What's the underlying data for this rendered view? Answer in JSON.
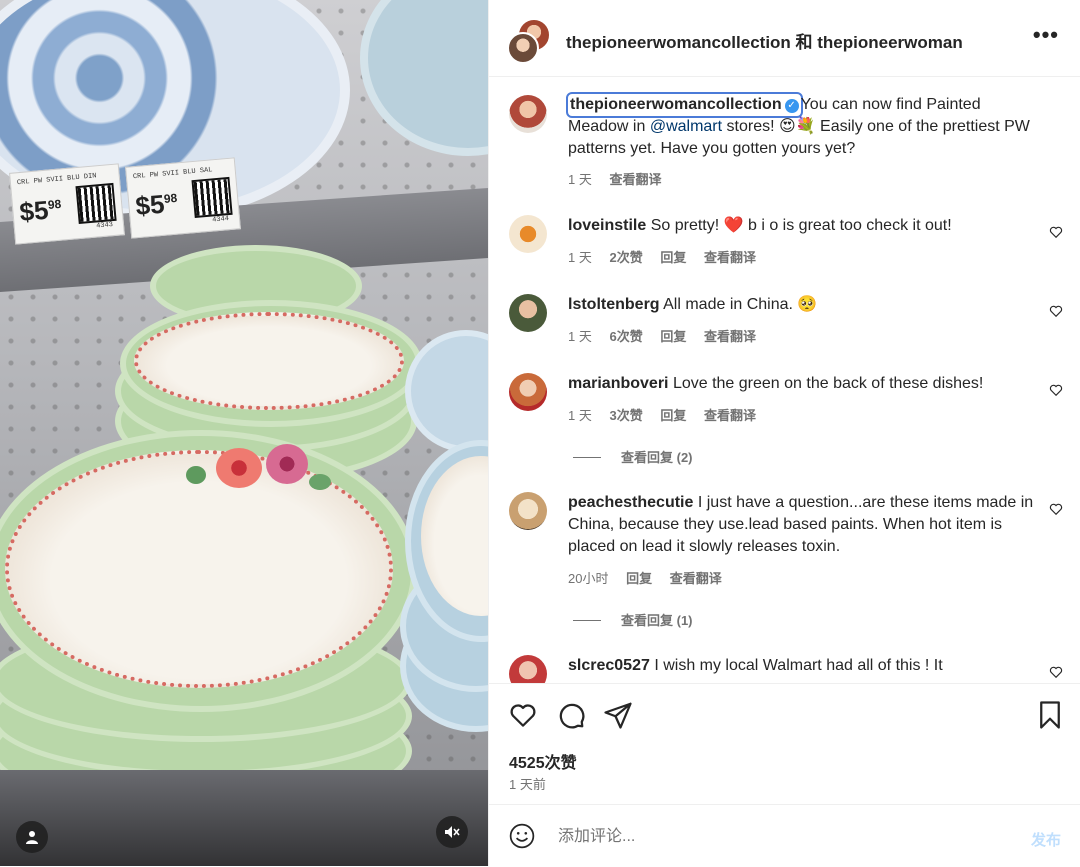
{
  "media": {
    "price_tags": [
      {
        "code": "CRL PW SVII BLU DIN",
        "price": "$5",
        "cents": "98",
        "num": "4343"
      },
      {
        "code": "CRL PW SVII BLU SAL",
        "price": "$5",
        "cents": "98",
        "num": "4344"
      }
    ],
    "profile_icon": "person-icon",
    "mute_icon": "speaker-muted-icon"
  },
  "header": {
    "title": "thepioneerwomancollection 和 thepioneerwoman",
    "more_icon": "•••"
  },
  "caption": {
    "user": "thepioneerwomancollection",
    "text_before": "You can now find Painted Meadow in ",
    "mention": "@walmart",
    "text_after": " stores! 😍💐 Easily one of the prettiest PW patterns yet. Have you gotten yours yet?",
    "time": "1 天",
    "translate": "查看翻译"
  },
  "comments": [
    {
      "user": "loveinstile",
      "text": "So pretty! ❤️ b i o is great too check it out!",
      "time": "1 天",
      "likes": "2次赞",
      "reply": "回复",
      "translate": "查看翻译"
    },
    {
      "user": "lstoltenberg",
      "text": "All made in China. 🥺",
      "time": "1 天",
      "likes": "6次赞",
      "reply": "回复",
      "translate": "查看翻译"
    },
    {
      "user": "marianboveri",
      "text": "Love the green on the back of these dishes!",
      "time": "1 天",
      "likes": "3次赞",
      "reply": "回复",
      "translate": "查看翻译",
      "view_replies": "查看回复 (2)"
    },
    {
      "user": "peachesthecutie",
      "text": "I just have a question...are these items made in China, because they use.lead based paints. When hot item is placed on lead it slowly releases toxin.",
      "time": "20小时",
      "reply": "回复",
      "translate": "查看翻译",
      "view_replies": "查看回复 (1)"
    },
    {
      "user": "slcrec0527",
      "text": "I wish my local Walmart had all of this ! It"
    }
  ],
  "actions": {
    "likes": "4525次赞",
    "posted": "1 天前"
  },
  "composer": {
    "placeholder": "添加评论...",
    "post_label": "发布"
  },
  "colors": {
    "accent": "#3897f0",
    "mention": "#00376b",
    "post_disabled": "#c0dffd",
    "heart_red": "#ed4956"
  }
}
